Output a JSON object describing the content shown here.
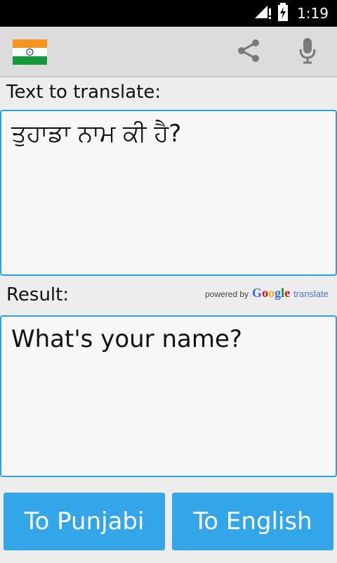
{
  "status_bar": {
    "time": "1:19",
    "icons": [
      "signal-icon",
      "battery-charging-icon"
    ]
  },
  "action_bar": {
    "language_flag": "india-flag-icon",
    "share_icon": "share-icon",
    "mic_icon": "microphone-icon"
  },
  "input": {
    "label": "Text to translate:",
    "value": "ਤੁਹਾਡਾ ਨਾਮ ਕੀ ਹੈ?"
  },
  "result": {
    "label": "Result:",
    "value": "What's your name?",
    "powered_by": {
      "prefix": "powered by",
      "brand": [
        "G",
        "o",
        "o",
        "g",
        "l",
        "e"
      ],
      "suffix": "translate"
    }
  },
  "buttons": {
    "to_punjabi": "To Punjabi",
    "to_english": "To English"
  },
  "colors": {
    "accent": "#33a6ea",
    "border": "#29a3e7",
    "background": "#ededed",
    "google": [
      "#3369e8",
      "#d50f25",
      "#eeb211",
      "#3369e8",
      "#009925",
      "#d50f25"
    ]
  }
}
